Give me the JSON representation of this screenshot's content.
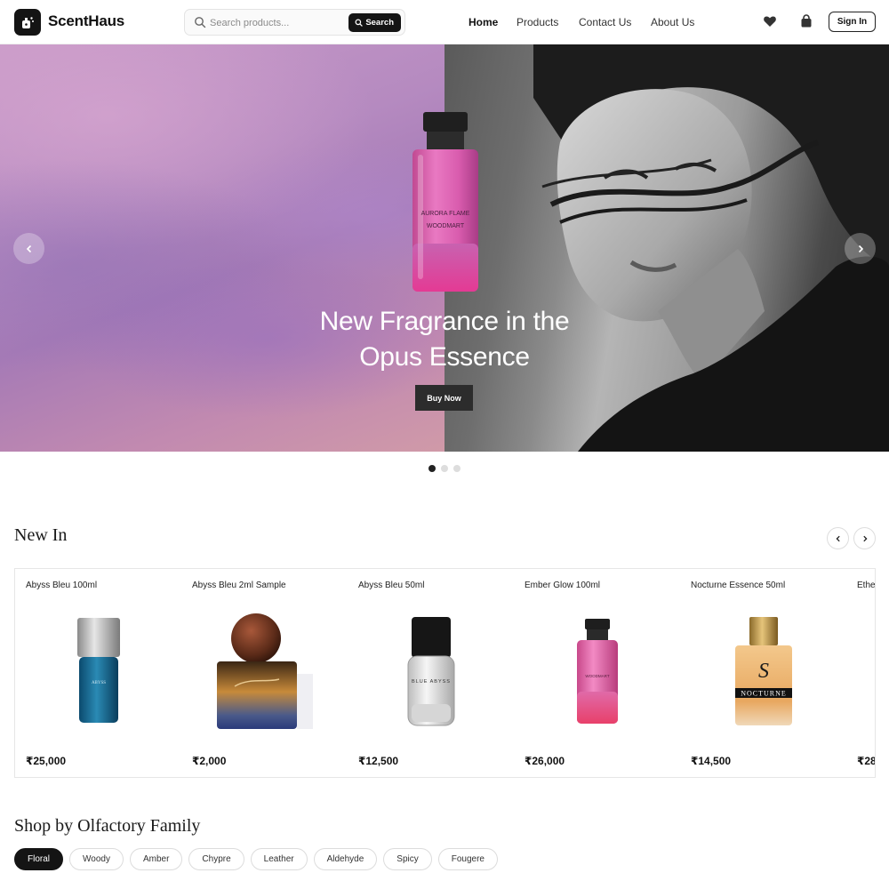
{
  "header": {
    "logo_text": "ScentHaus",
    "search": {
      "placeholder": "Search products...",
      "button_label": "Search"
    },
    "nav": [
      {
        "label": "Home",
        "active": true
      },
      {
        "label": "Products",
        "active": false
      },
      {
        "label": "Contact Us",
        "active": false
      },
      {
        "label": "About Us",
        "active": false
      }
    ],
    "icons": [
      "heart-icon",
      "bag-icon"
    ],
    "signin_label": "Sign In"
  },
  "hero": {
    "bottle_label_1": "AURORA FLAME",
    "bottle_label_2": "WOODMART",
    "title_line1": "New Fragrance in the",
    "title_line2": "Opus Essence",
    "cta_label": "Buy Now",
    "active_slide": 1,
    "slide_count": 3
  },
  "new_in": {
    "title": "New In",
    "products": [
      {
        "name": "Abyss Bleu 100ml",
        "price": "₹25,000",
        "label": "ABYSS"
      },
      {
        "name": "Abyss Bleu 2ml Sample",
        "price": "₹2,000",
        "label": ""
      },
      {
        "name": "Abyss Bleu 50ml",
        "price": "₹12,500",
        "label": "BLUE ABYSS"
      },
      {
        "name": "Ember Glow 100ml",
        "price": "₹26,000",
        "label": "WOODMART"
      },
      {
        "name": "Nocturne Essence 50ml",
        "price": "₹14,500",
        "label": "NOCTURNE"
      },
      {
        "name": "Ethe",
        "price": "₹28",
        "label": ""
      }
    ]
  },
  "families": {
    "title": "Shop by Olfactory Family",
    "chips": [
      {
        "label": "Floral",
        "active": true
      },
      {
        "label": "Woody",
        "active": false
      },
      {
        "label": "Amber",
        "active": false
      },
      {
        "label": "Chypre",
        "active": false
      },
      {
        "label": "Leather",
        "active": false
      },
      {
        "label": "Aldehyde",
        "active": false
      },
      {
        "label": "Spicy",
        "active": false
      },
      {
        "label": "Fougere",
        "active": false
      }
    ]
  },
  "colors": {
    "accent": "#141414",
    "hero_pink": "#c89ac8",
    "bottle_pink": "#e2569e"
  }
}
